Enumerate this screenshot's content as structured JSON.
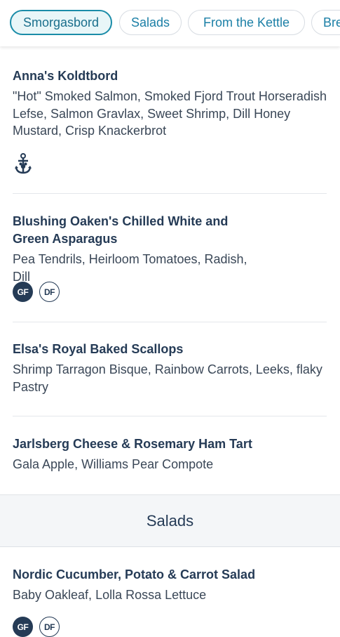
{
  "tabs": [
    {
      "label": "Smorgasbord",
      "active": true
    },
    {
      "label": "Salads",
      "active": false
    },
    {
      "label": "From the Kettle",
      "active": false
    },
    {
      "label": "Bre",
      "active": false
    }
  ],
  "items": [
    {
      "title": "Anna's Koldtbord",
      "description": "\"Hot\" Smoked Salmon, Smoked Fjord Trout Horseradish Lefse, Salmon Gravlax, Sweet Shrimp, Dill Honey Mustard, Crisp Knackerbrot",
      "icon": "mickey-anchor-icon"
    },
    {
      "title": "Blushing Oaken's Chilled White and Green Asparagus",
      "description": "Pea Tendrils, Heirloom Tomatoes, Radish, Dill",
      "badges": [
        "GF",
        "DF"
      ]
    },
    {
      "title": "Elsa's Royal Baked Scallops",
      "description": "Shrimp Tarragon Bisque, Rainbow Carrots, Leeks, flaky Pastry"
    },
    {
      "title": "Jarlsberg Cheese & Rosemary Ham Tart",
      "description": "Gala Apple, Williams Pear Compote"
    }
  ],
  "section": {
    "title": "Salads"
  },
  "salad_items": [
    {
      "title": "Nordic Cucumber, Potato & Carrot Salad",
      "description": "Baby Oakleaf, Lolla Rossa Lettuce",
      "badges": [
        "GF",
        "DF"
      ]
    }
  ],
  "colors": {
    "accent": "#1a8ca8",
    "text": "#253b56",
    "badge": "#253b56"
  }
}
